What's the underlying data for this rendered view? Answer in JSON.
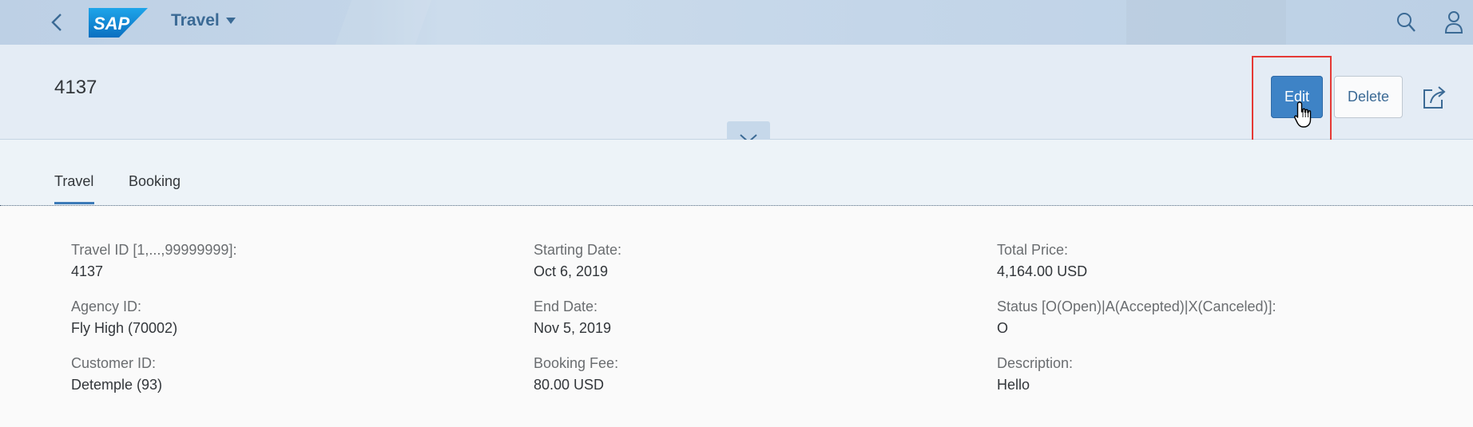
{
  "shell": {
    "app_title": "Travel",
    "logo_text": "SAP"
  },
  "header": {
    "object_title": "4137",
    "edit_label": "Edit",
    "delete_label": "Delete"
  },
  "tabs": [
    {
      "label": "Travel",
      "selected": true
    },
    {
      "label": "Booking",
      "selected": false
    }
  ],
  "form": {
    "col1": [
      {
        "label": "Travel ID [1,...,99999999]:",
        "value": "4137"
      },
      {
        "label": "Agency ID:",
        "value": "Fly High (70002)"
      },
      {
        "label": "Customer ID:",
        "value": "Detemple (93)"
      }
    ],
    "col2": [
      {
        "label": "Starting Date:",
        "value": "Oct 6, 2019"
      },
      {
        "label": "End Date:",
        "value": "Nov 5, 2019"
      },
      {
        "label": "Booking Fee:",
        "value": "80.00  USD"
      }
    ],
    "col3": [
      {
        "label": "Total Price:",
        "value": "4,164.00  USD"
      },
      {
        "label": "Status [O(Open)|A(Accepted)|X(Canceled)]:",
        "value": "O"
      },
      {
        "label": "Description:",
        "value": "Hello"
      }
    ]
  },
  "colors": {
    "accent": "#3e83c6",
    "highlight_box": "#e53935",
    "shell_bg": "#c3d5e8"
  },
  "icons": [
    "back-arrow-icon",
    "sap-logo",
    "caret-down-icon",
    "search-icon",
    "user-icon",
    "share-icon",
    "chevron-down-icon",
    "hand-cursor-icon"
  ]
}
